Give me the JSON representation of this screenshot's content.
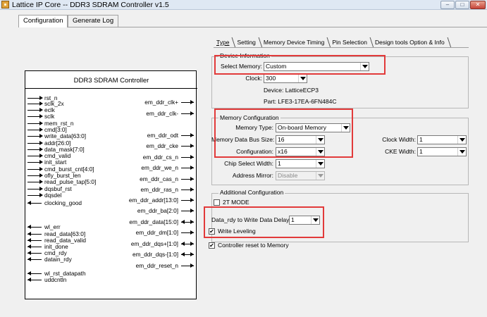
{
  "window": {
    "title": "Lattice IP Core -- DDR3 SDRAM Controller v1.5",
    "minimize_glyph": "–",
    "maximize_glyph": "□",
    "close_glyph": "✕"
  },
  "main_tabs": [
    "Configuration",
    "Generate Log"
  ],
  "sub_tabs": [
    "Type",
    "Setting",
    "Memory Device Timing",
    "Pin Selection",
    "Design tools Option & Info"
  ],
  "diagram": {
    "title": "DDR3 SDRAM Controller",
    "left_signals": [
      {
        "name": "rst_n",
        "dir": "in"
      },
      {
        "name": "sclk_2x",
        "dir": "in"
      },
      {
        "name": "eclk",
        "dir": "in"
      },
      {
        "name": "sclk",
        "dir": "in"
      },
      {
        "name": "mem_rst_n",
        "dir": "in"
      },
      {
        "name": "cmd[3:0]",
        "dir": "in"
      },
      {
        "name": "write_data[63:0]",
        "dir": "in"
      },
      {
        "name": "addr[26:0]",
        "dir": "in"
      },
      {
        "name": "data_mask[7:0]",
        "dir": "in"
      },
      {
        "name": "cmd_valid",
        "dir": "in"
      },
      {
        "name": "init_start",
        "dir": "in"
      },
      {
        "name": "cmd_burst_cnt[4:0]",
        "dir": "in"
      },
      {
        "name": "ofly_burst_len",
        "dir": "in"
      },
      {
        "name": "read_pulse_tap[5:0]",
        "dir": "in"
      },
      {
        "name": "dqsbuf_rst",
        "dir": "in"
      },
      {
        "name": "dqsdel",
        "dir": "in"
      },
      {
        "name": "clocking_good",
        "dir": "out"
      },
      {
        "name": "wl_err",
        "dir": "out"
      },
      {
        "name": "read_data[63:0]",
        "dir": "out"
      },
      {
        "name": "read_data_valid",
        "dir": "out"
      },
      {
        "name": "init_done",
        "dir": "out"
      },
      {
        "name": "cmd_rdy",
        "dir": "out"
      },
      {
        "name": "datain_rdy",
        "dir": "out"
      },
      {
        "name": "wl_rst_datapath",
        "dir": "out"
      },
      {
        "name": "uddcntln",
        "dir": "out"
      }
    ],
    "right_signals": [
      {
        "name": "em_ddr_clk+",
        "dir": "out"
      },
      {
        "name": "em_ddr_clk-",
        "dir": "out"
      },
      {
        "name": "em_ddr_odt",
        "dir": "out"
      },
      {
        "name": "em_ddr_cke",
        "dir": "out"
      },
      {
        "name": "em_ddr_cs_n",
        "dir": "out"
      },
      {
        "name": "em_ddr_we_n",
        "dir": "out"
      },
      {
        "name": "em_ddr_cas_n",
        "dir": "out"
      },
      {
        "name": "em_ddr_ras_n",
        "dir": "out"
      },
      {
        "name": "em_ddr_addr[13:0]",
        "dir": "out"
      },
      {
        "name": "em_ddr_ba[2:0]",
        "dir": "out"
      },
      {
        "name": "em_ddr_data[15:0]",
        "dir": "bi"
      },
      {
        "name": "em_ddr_dm[1:0]",
        "dir": "out"
      },
      {
        "name": "em_ddr_dqs+[1:0]",
        "dir": "bi"
      },
      {
        "name": "em_ddr_dqs-[1:0]",
        "dir": "bi"
      },
      {
        "name": "em_ddr_reset_n",
        "dir": "out"
      }
    ]
  },
  "device_information": {
    "group_label": "Device Information",
    "select_memory_label": "Select Memory:",
    "select_memory_value": "Custom",
    "clock_label": "Clock:",
    "clock_value": "300",
    "device_text": "Device: LatticeECP3",
    "part_text": "Part: LFE3-17EA-6FN484C"
  },
  "memory_configuration": {
    "group_label": "Memory Configuration",
    "memory_type_label": "Memory Type:",
    "memory_type_value": "On-board Memory",
    "data_bus_label": "Memory Data Bus Size:",
    "data_bus_value": "16",
    "configuration_label": "Configuration:",
    "configuration_value": "x16",
    "chip_select_label": "Chip Select Width:",
    "chip_select_value": "1",
    "address_mirror_label": "Address Mirror:",
    "address_mirror_value": "Disable",
    "clock_width_label": "Clock Width:",
    "clock_width_value": "1",
    "cke_width_label": "CKE Width:",
    "cke_width_value": "1"
  },
  "additional_configuration": {
    "group_label": "Additional Configuration",
    "two_t_mode_label": "2T MODE",
    "two_t_mode_checked": false,
    "data_rdy_label": "Data_rdy to Write Data Delay:",
    "data_rdy_value": "1",
    "write_leveling_label": "Write Leveling",
    "write_leveling_checked": true,
    "controller_reset_label": "Controller reset to Memory",
    "controller_reset_checked": true,
    "check_glyph": "✔"
  },
  "colors": {
    "highlight_red": "#e23a3a",
    "window_bg": "#f0f0f0",
    "titlebar_bg": "#dfe8f3"
  }
}
